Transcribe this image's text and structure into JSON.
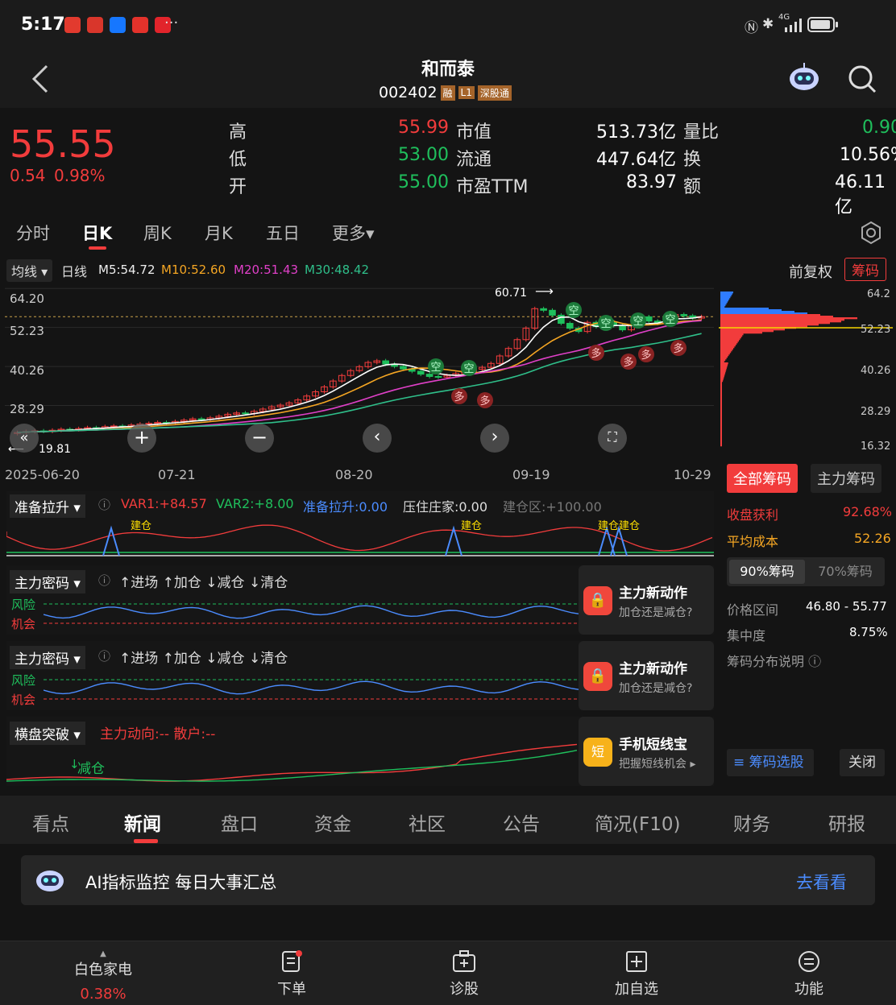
{
  "status": {
    "time": "5:17",
    "network": "4G",
    "more": "···"
  },
  "header": {
    "title": "和而泰",
    "code": "002402",
    "badges": [
      "融",
      "L1",
      "深股通"
    ]
  },
  "quote": {
    "price": "55.55",
    "change": "0.54",
    "change_pct": "0.98%",
    "high_label": "高",
    "high": "55.99",
    "low_label": "低",
    "low": "53.00",
    "open_label": "开",
    "open": "55.00",
    "mcap_label": "市值",
    "mcap": "513.73亿",
    "float_label": "流通",
    "float": "447.64亿",
    "pe_label": "市盈TTM",
    "pe": "83.97",
    "vr_label": "量比",
    "vr": "0.90",
    "turn_label": "换",
    "turn": "10.56%",
    "amt_label": "额",
    "amt": "46.11亿"
  },
  "period_tabs": [
    "分时",
    "日K",
    "周K",
    "月K",
    "五日",
    "更多▾"
  ],
  "ma_bar": {
    "selector": "均线",
    "period": "日线",
    "m5": "M5:54.72",
    "m10": "M10:52.60",
    "m20": "M20:51.43",
    "m30": "M30:48.42",
    "adjust": "前复权",
    "chips": "筹码"
  },
  "chart_data": {
    "type": "candlestick",
    "y_ticks": [
      "64.20",
      "52.23",
      "40.26",
      "28.29"
    ],
    "x_ticks": [
      "2025-06-20",
      "07-21",
      "08-20",
      "09-19",
      "10-29"
    ],
    "high_marker": "60.71",
    "low_marker": "19.81",
    "closes": [
      20.0,
      20.3,
      20.5,
      20.4,
      20.7,
      21.0,
      20.9,
      21.2,
      21.5,
      21.4,
      21.8,
      22.0,
      21.9,
      22.3,
      22.6,
      22.8,
      23.1,
      23.0,
      23.4,
      23.8,
      24.2,
      24.0,
      24.5,
      25.0,
      25.6,
      26.0,
      25.8,
      26.5,
      27.2,
      27.9,
      28.4,
      29.1,
      30.0,
      31.2,
      32.5,
      34.0,
      35.8,
      37.5,
      39.0,
      40.2,
      41.5,
      42.0,
      41.0,
      40.3,
      39.5,
      38.8,
      37.9,
      37.2,
      37.0,
      37.5,
      38.1,
      38.5,
      39.4,
      40.0,
      41.2,
      43.5,
      45.8,
      48.5,
      52.0,
      58.0,
      57.5,
      56.0,
      53.5,
      52.0,
      51.0,
      53.8,
      52.5,
      54.0,
      52.8,
      51.5,
      53.0,
      55.5,
      54.2,
      53.5,
      55.0,
      56.2,
      55.8,
      55.1,
      55.55
    ],
    "signals_top": [
      "空",
      "空",
      "空",
      "空",
      "空",
      "空",
      "空"
    ],
    "signals_bottom": [
      "多",
      "多",
      "多",
      "多",
      "多",
      "多",
      "多"
    ],
    "chip_prices": [
      "64.2",
      "52.23",
      "40.26",
      "28.29",
      "16.32"
    ]
  },
  "chip_panel": {
    "tab_all": "全部筹码",
    "tab_main": "主力筹码",
    "profit_label": "收盘获利",
    "profit": "92.68%",
    "cost_label": "平均成本",
    "cost": "52.26",
    "seg90": "90%筹码",
    "seg70": "70%筹码",
    "range_label": "价格区间",
    "range": "46.80 - 55.77",
    "conc_label": "集中度",
    "conc": "8.75%",
    "explain": "筹码分布说明",
    "select_btn": "筹码选股",
    "close_btn": "关闭"
  },
  "ind1": {
    "name": "准备拉升",
    "var1": "VAR1:+84.57",
    "var2": "VAR2:+8.00",
    "prep": "准备拉升:0.00",
    "press": "压住庄家:0.00",
    "build": "建仓区:+100.00",
    "tag": "建仓"
  },
  "ind2": {
    "name": "主力密码",
    "signals": "↑进场 ↑加仓 ↓减仓 ↓清仓",
    "risk": "风险",
    "chance": "机会",
    "ad_title": "主力新动作",
    "ad_sub": "加仓还是减仓?"
  },
  "ind3": {
    "name": "主力密码",
    "signals": "↑进场 ↑加仓 ↓减仓 ↓清仓",
    "risk": "风险",
    "chance": "机会",
    "ad_title": "主力新动作",
    "ad_sub": "加仓还是减仓?"
  },
  "ind4": {
    "name": "横盘突破",
    "main": "主力动向:-- 散户:--",
    "tag": "减仓",
    "ad_title": "手机短线宝",
    "ad_sub": "把握短线机会 ▸",
    "ad_icon": "短"
  },
  "bottom_tabs": [
    "看点",
    "新闻",
    "盘口",
    "资金",
    "社区",
    "公告",
    "简况(F10)",
    "财务",
    "研报"
  ],
  "ai_banner": {
    "text": "AI指标监控 每日大事汇总",
    "link": "去看看"
  },
  "footer": {
    "sector": "白色家电",
    "sector_pct": "0.38%",
    "order": "下单",
    "diag": "诊股",
    "add": "加自选",
    "func": "功能"
  }
}
